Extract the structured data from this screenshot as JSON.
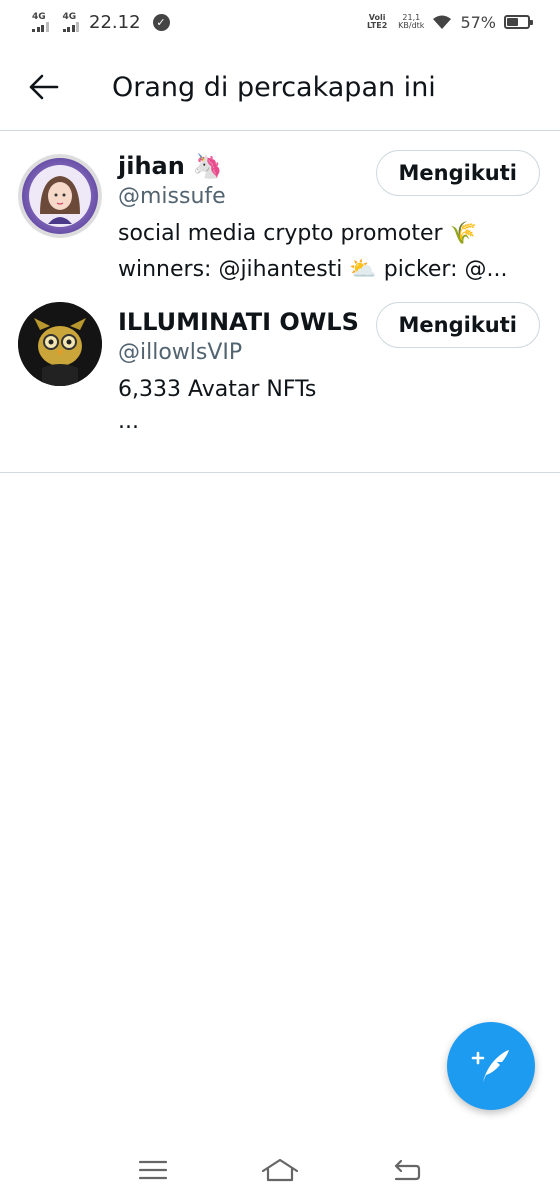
{
  "status_bar": {
    "network1": "4G",
    "network2": "4G",
    "time": "22.12",
    "volte": "Voli LTE2",
    "speed_value": "21,1",
    "speed_unit": "KB/dtk",
    "battery_percent": "57%",
    "battery_level": 0.57
  },
  "header": {
    "title": "Orang di percakapan ini",
    "back_icon": "arrow-left-icon"
  },
  "users": [
    {
      "name": "jihan",
      "emoji": "🦄",
      "handle": "@missufe",
      "bio_line1": "social media crypto promoter 🌾",
      "bio_line2": "winners: @jihantesti ⛅ picker: @...",
      "follow_label": "Mengikuti"
    },
    {
      "name": "ILLUMINATI OWLS",
      "emoji": "",
      "handle": "@illowlsVIP",
      "bio_line1": "6,333 Avatar NFTs",
      "bio_line2": "...",
      "follow_label": "Mengikuti"
    }
  ],
  "fab": {
    "icon": "compose-tweet-icon",
    "color": "#1d9bf0"
  },
  "nav": {
    "menu_icon": "menu-icon",
    "home_icon": "home-icon",
    "back_icon": "back-icon"
  },
  "colors": {
    "accent": "#1d9bf0",
    "text_primary": "#0f1419",
    "text_secondary": "#536471",
    "border": "#cfd9de"
  }
}
